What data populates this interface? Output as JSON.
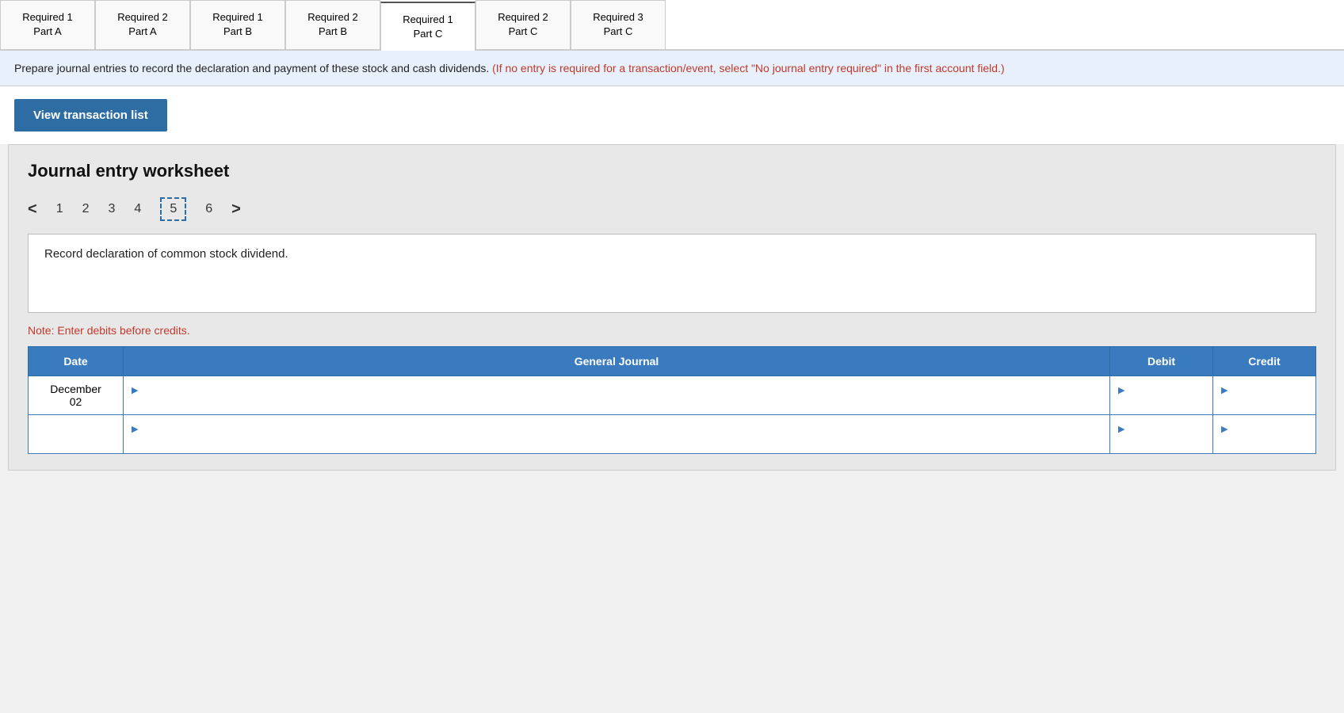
{
  "tabs": [
    {
      "id": "req1a",
      "label": "Required 1\nPart A",
      "active": false
    },
    {
      "id": "req2a",
      "label": "Required 2\nPart A",
      "active": false
    },
    {
      "id": "req1b",
      "label": "Required 1\nPart B",
      "active": false
    },
    {
      "id": "req2b",
      "label": "Required 2\nPart B",
      "active": false
    },
    {
      "id": "req1c",
      "label": "Required 1\nPart C",
      "active": true
    },
    {
      "id": "req2c",
      "label": "Required 2\nPart C",
      "active": false
    },
    {
      "id": "req3c",
      "label": "Required 3\nPart C",
      "active": false
    }
  ],
  "instruction": {
    "main_text": "Prepare journal entries to record the declaration and payment of these stock and cash dividends. ",
    "red_text": "(If no entry is required for a transaction/event, select \"No journal entry required\" in the first account field.)"
  },
  "view_transaction_btn": "View transaction list",
  "worksheet": {
    "title": "Journal entry worksheet",
    "pages": [
      "1",
      "2",
      "3",
      "4",
      "5",
      "6"
    ],
    "active_page": "5",
    "description": "Record declaration of common stock dividend.",
    "note": "Note: Enter debits before credits.",
    "table": {
      "headers": [
        "Date",
        "General Journal",
        "Debit",
        "Credit"
      ],
      "rows": [
        {
          "date": "December\n02",
          "journal": "",
          "debit": "",
          "credit": ""
        },
        {
          "date": "",
          "journal": "",
          "debit": "",
          "credit": ""
        }
      ]
    }
  },
  "navigation": {
    "prev_arrow": "<",
    "next_arrow": ">"
  }
}
